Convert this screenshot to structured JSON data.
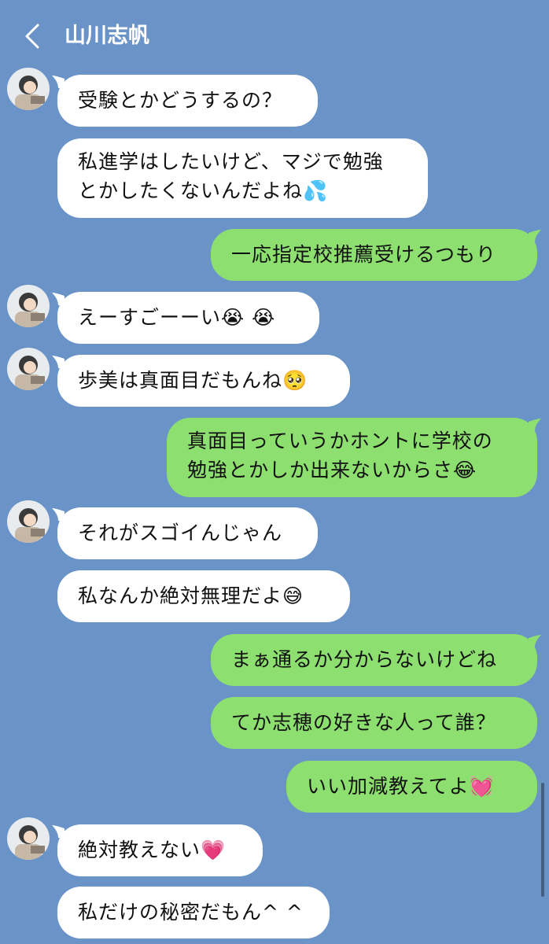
{
  "header": {
    "title": "山川志帆"
  },
  "messages": [
    {
      "side": "in",
      "text": "受験とかどうするの？",
      "avatar": true
    },
    {
      "side": "in",
      "line1": "私進学はしたいけど、マジで勉強",
      "line2": "とかしたくないんだよね",
      "emoji": "💦"
    },
    {
      "side": "out",
      "text": "一応指定校推薦受けるつもり"
    },
    {
      "side": "in",
      "text": "えーすごーーい",
      "emoji": "😭 😭",
      "avatar": true
    },
    {
      "side": "in",
      "text": "歩美は真面目だもんね",
      "emoji": "🥺",
      "avatar": true
    },
    {
      "side": "out",
      "line1": "真面目っていうかホントに学校の",
      "line2": "勉強とかしか出来ないからさ",
      "emoji": "😂"
    },
    {
      "side": "in",
      "text": "それがスゴイんじゃん",
      "avatar": true
    },
    {
      "side": "in",
      "text": "私なんか絶対無理だよ",
      "emoji": "😅"
    },
    {
      "side": "out",
      "text": "まぁ通るか分からないけどね"
    },
    {
      "side": "out",
      "text": "てか志穂の好きな人って誰？"
    },
    {
      "side": "out",
      "text": "いい加減教えてよ",
      "emoji": "💓"
    },
    {
      "side": "in",
      "text": "絶対教えない",
      "emoji": "💗",
      "avatar": true
    },
    {
      "side": "in",
      "text": "私だけの秘密だもん^ ^"
    }
  ],
  "colors": {
    "background": "#6a93c8",
    "incoming_bubble": "#ffffff",
    "outgoing_bubble": "#8ddf6f"
  }
}
